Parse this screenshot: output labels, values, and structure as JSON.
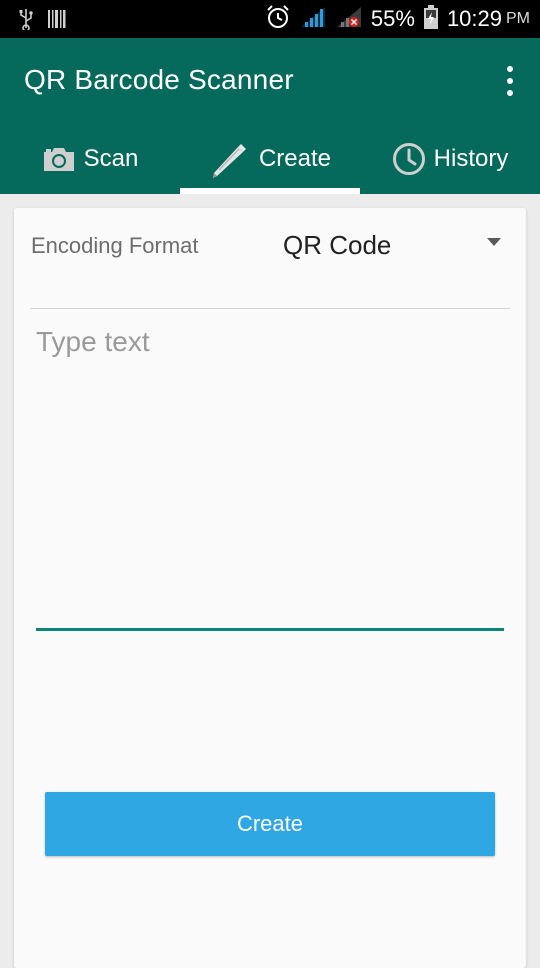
{
  "status_bar": {
    "battery": "55%",
    "time": "10:29",
    "ampm": "PM",
    "icons": [
      "usb-icon",
      "barcode-notification-icon",
      "alarm-icon",
      "signal-icon",
      "signal-no-data-icon",
      "battery-icon"
    ]
  },
  "app_bar": {
    "title": "QR Barcode Scanner",
    "overflow_icon": "more-vert-icon"
  },
  "tabs": [
    {
      "label": "Scan",
      "icon": "camera-icon",
      "selected": false
    },
    {
      "label": "Create",
      "icon": "pencil-icon",
      "selected": true
    },
    {
      "label": "History",
      "icon": "clock-icon",
      "selected": false
    }
  ],
  "form": {
    "encoding_label": "Encoding Format",
    "encoding_value": "QR Code",
    "text_placeholder": "Type text",
    "text_value": "",
    "create_button": "Create"
  },
  "colors": {
    "app_bar": "#05695b",
    "accent_underline": "#0a8577",
    "button": "#2fa7e2",
    "status_bar": "#000000"
  }
}
